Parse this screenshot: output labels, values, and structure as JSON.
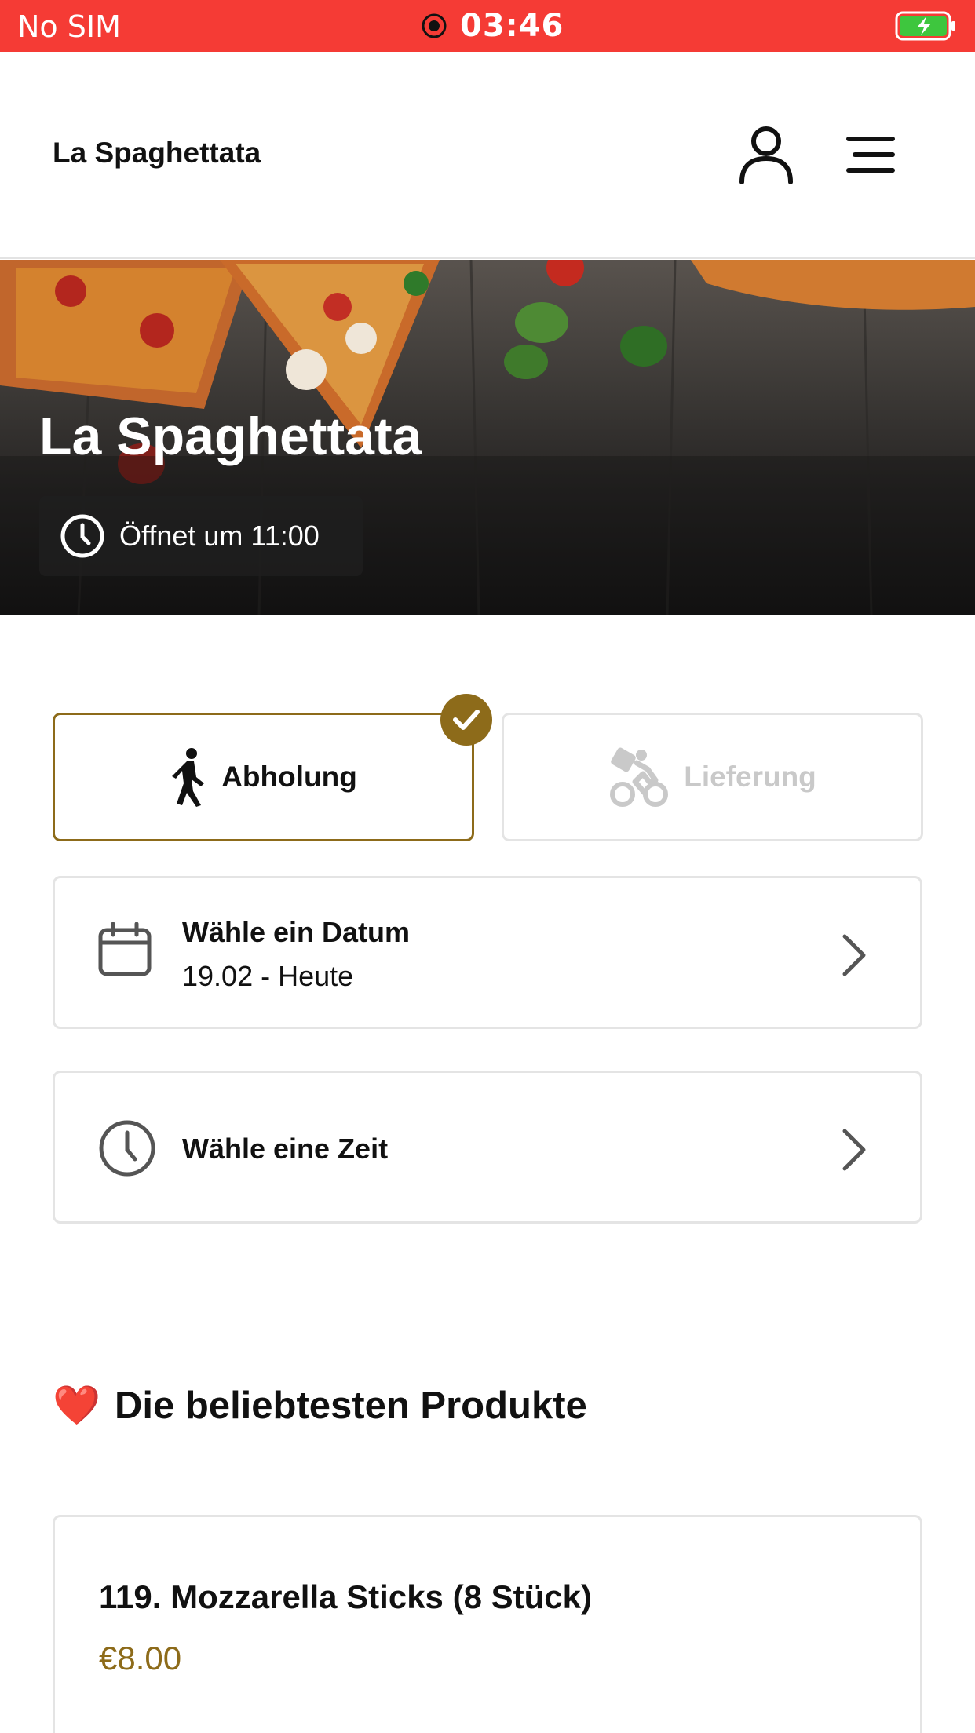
{
  "status_bar": {
    "carrier": "No SIM",
    "time": "03:46",
    "icons": [
      "record-icon",
      "battery-charging-icon"
    ],
    "color": "#f53b35"
  },
  "header": {
    "title": "La Spaghettata",
    "icons": [
      "account-icon",
      "menu-icon"
    ]
  },
  "hero": {
    "title": "La Spaghettata",
    "hours": "Öffnet um 11:00"
  },
  "modes": {
    "pickup": {
      "label": "Abholung",
      "selected": true,
      "icon": "walking-icon"
    },
    "delivery": {
      "label": "Lieferung",
      "selected": false,
      "icon": "delivery-bike-icon"
    }
  },
  "date_selector": {
    "label": "Wähle ein Datum",
    "value": "19.02 - Heute",
    "icon": "calendar-icon"
  },
  "time_selector": {
    "label": "Wähle eine Zeit",
    "icon": "clock-icon"
  },
  "popular": {
    "emoji": "❤️",
    "title": "Die beliebtesten Produkte",
    "products": [
      {
        "name": "119. Mozzarella Sticks (8 Stück)",
        "price": "€8.00"
      }
    ]
  },
  "colors": {
    "accent": "#8d6b1a",
    "border": "#e4e4e4",
    "disabled": "#c9c9c9"
  }
}
